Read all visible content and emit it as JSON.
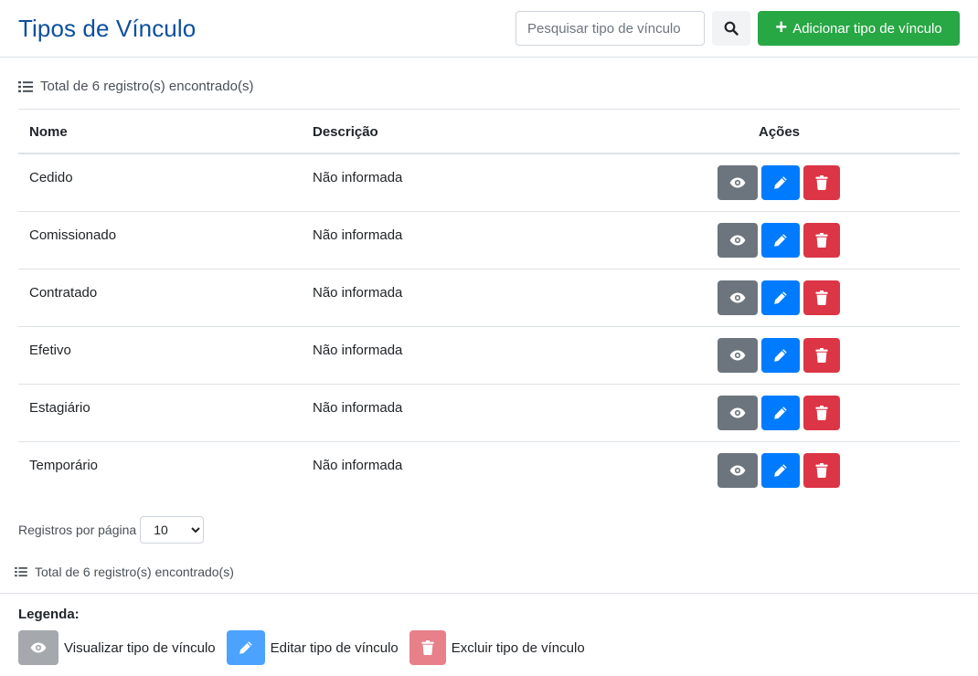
{
  "header": {
    "title": "Tipos de Vínculo",
    "search_placeholder": "Pesquisar tipo de vínculo",
    "add_button_label": "Adicionar tipo de vínculo"
  },
  "summary": {
    "total_text": "Total de 6 registro(s) encontrado(s)"
  },
  "table": {
    "columns": [
      "Nome",
      "Descrição",
      "Ações"
    ],
    "rows": [
      {
        "name": "Cedido",
        "description": "Não informada"
      },
      {
        "name": "Comissionado",
        "description": "Não informada"
      },
      {
        "name": "Contratado",
        "description": "Não informada"
      },
      {
        "name": "Efetivo",
        "description": "Não informada"
      },
      {
        "name": "Estagiário",
        "description": "Não informada"
      },
      {
        "name": "Temporário",
        "description": "Não informada"
      }
    ],
    "action_icons": [
      "eye-icon",
      "pencil-icon",
      "trash-icon"
    ]
  },
  "pagination": {
    "per_page_label": "Registros por página",
    "per_page_value": "10"
  },
  "legend": {
    "title": "Legenda:",
    "items": [
      {
        "label": "Visualizar tipo de vínculo",
        "icon": "eye-icon"
      },
      {
        "label": "Editar tipo de vínculo",
        "icon": "pencil-icon"
      },
      {
        "label": "Excluir tipo de vínculo",
        "icon": "trash-icon"
      }
    ]
  },
  "colors": {
    "title": "#0d4fa0",
    "add": "#28a745",
    "view": "#6c757d",
    "edit": "#007bff",
    "delete": "#dc3545"
  }
}
